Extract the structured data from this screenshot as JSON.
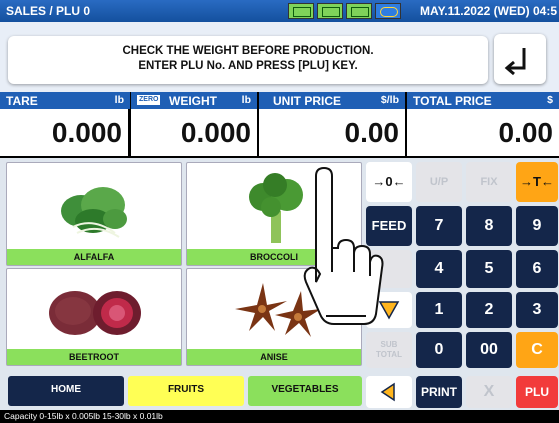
{
  "header": {
    "title": "SALES / PLU 0",
    "datetime": "MAY.11.2022 (WED) 04:5",
    "indicators": [
      "status-indicator-1",
      "status-indicator-2",
      "status-indicator-3",
      "network-indicator"
    ]
  },
  "message": {
    "line1": "CHECK THE WEIGHT BEFORE PRODUCTION.",
    "line2": "ENTER PLU No. AND PRESS [PLU] KEY."
  },
  "fields": {
    "tare": {
      "label": "TARE",
      "unit": "lb",
      "value": "0.000"
    },
    "weight": {
      "label": "WEIGHT",
      "unit": "lb",
      "value": "0.000",
      "badge": "ZERO"
    },
    "unit_price": {
      "label": "UNIT PRICE",
      "unit": "$/lb",
      "value": "0.00"
    },
    "total_price": {
      "label": "TOTAL PRICE",
      "unit": "$",
      "value": "0.00"
    }
  },
  "products": [
    "ALFALFA",
    "BROCCOLI",
    "BEETROOT",
    "ANISE"
  ],
  "keys": {
    "zero": "→0←",
    "up": "U/P",
    "fix": "FIX",
    "tare": "→T←",
    "feed": "FEED",
    "n7": "7",
    "n8": "8",
    "n9": "9",
    "n4": "4",
    "n5": "5",
    "n6": "6",
    "n1": "1",
    "n2": "2",
    "n3": "3",
    "sub1": "SUB",
    "sub2": "TOTAL",
    "n0": "0",
    "n00": "00",
    "clear": "C",
    "print": "PRINT",
    "x": "X",
    "plu": "PLU"
  },
  "nav": {
    "home": "HOME",
    "fruits": "FRUITS",
    "vegetables": "VEGETABLES"
  },
  "status": "Capacity 0-15lb x 0.005lb  15-30lb x 0.01lb",
  "colors": {
    "header_blue": "#1f5fb5",
    "label_green": "#8be05c",
    "key_dark": "#14264a",
    "key_orange": "#ffa515",
    "key_red": "#f23b3b",
    "fruits_yellow": "#ffff55"
  }
}
